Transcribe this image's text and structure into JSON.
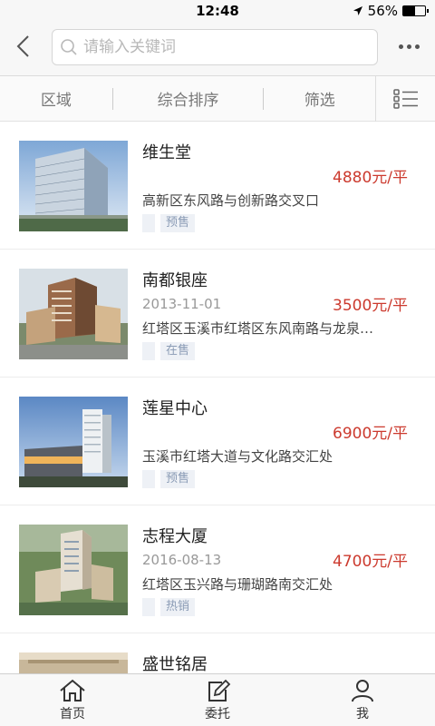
{
  "status": {
    "time": "12:48",
    "battery": "56%",
    "battery_level": 0.56
  },
  "search": {
    "placeholder": "请输入关键词"
  },
  "filters": {
    "area": "区域",
    "sort": "综合排序",
    "filter": "筛选"
  },
  "listings": [
    {
      "name": "维生堂",
      "date": "",
      "price": "4880元/平",
      "address": "高新区东风路与创新路交叉口",
      "tag": "预售"
    },
    {
      "name": "南都银座",
      "date": "2013-11-01",
      "price": "3500元/平",
      "address": "红塔区玉溪市红塔区东风南路与龙泉…",
      "tag": "在售"
    },
    {
      "name": "莲星中心",
      "date": "",
      "price": "6900元/平",
      "address": "玉溪市红塔大道与文化路交汇处",
      "tag": "预售"
    },
    {
      "name": "志程大厦",
      "date": "2016-08-13",
      "price": "4700元/平",
      "address": "红塔区玉兴路与珊瑚路南交汇处",
      "tag": "热销"
    },
    {
      "name": "盛世铭居",
      "date": "",
      "price": "",
      "address": "",
      "tag": ""
    }
  ],
  "tabs": [
    {
      "label": "首页",
      "icon": "home-icon"
    },
    {
      "label": "委托",
      "icon": "edit-icon"
    },
    {
      "label": "我",
      "icon": "user-icon"
    }
  ]
}
